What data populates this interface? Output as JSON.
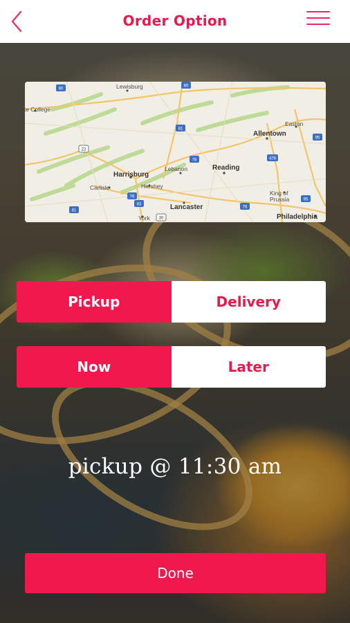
{
  "header": {
    "title": "Order Option",
    "back_icon": "chevron-left-icon",
    "menu_icon": "hamburger-menu-icon"
  },
  "map": {
    "places": [
      "Lewisburg",
      "State College",
      "Harrisburg",
      "Hershey",
      "Lebanon",
      "Reading",
      "Allentown",
      "Easton",
      "Carlisle",
      "Lancaster",
      "York",
      "King of Prussia",
      "Philadelphia"
    ],
    "route_shields": [
      "80",
      "80",
      "81",
      "22",
      "78",
      "476",
      "83",
      "76",
      "81",
      "76",
      "30",
      "95",
      "476",
      "76",
      "95"
    ]
  },
  "order_type": {
    "pickup": "Pickup",
    "delivery": "Delivery",
    "selected": "pickup"
  },
  "timing": {
    "now": "Now",
    "later": "Later",
    "selected": "now"
  },
  "status_text": "pickup @ 11:30 am",
  "done_label": "Done",
  "colors": {
    "accent": "#f0184d",
    "header_bg": "#ffffff",
    "inactive_bg": "#ffffff"
  }
}
